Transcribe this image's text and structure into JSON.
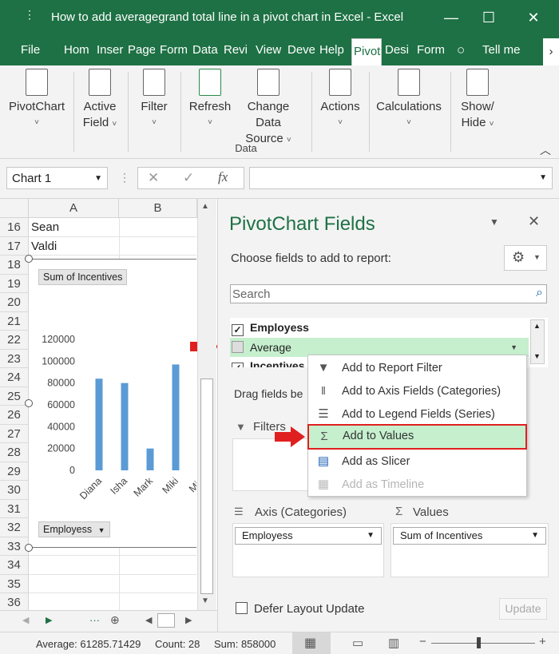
{
  "window": {
    "title": "How to add averagegrand total line in a pivot chart in Excel  -  Excel",
    "minimize": "—",
    "restore": "☐",
    "close": "✕"
  },
  "tabs": [
    "File",
    "Hom",
    "Inser",
    "Page",
    "Form",
    "Data",
    "Revi",
    "View",
    "Deve",
    "Help",
    "Pivot",
    "Desi",
    "Form",
    "Tell me"
  ],
  "ribbon": {
    "pivotchart": "PivotChart",
    "active_field_1": "Active",
    "active_field_2": "Field",
    "filter": "Filter",
    "refresh": "Refresh",
    "change_data_1": "Change Data",
    "change_data_2": "Source",
    "data_group": "Data",
    "actions": "Actions",
    "calculations": "Calculations",
    "showhide_1": "Show/",
    "showhide_2": "Hide"
  },
  "formula_bar": {
    "name_box": "Chart 1",
    "fx": "fx"
  },
  "grid": {
    "columns": [
      "A",
      "B"
    ],
    "rows": [
      "16",
      "17",
      "18",
      "19",
      "20",
      "21",
      "22",
      "23",
      "24",
      "25",
      "26",
      "27",
      "28",
      "29",
      "30",
      "31",
      "32",
      "33",
      "34",
      "35",
      "36"
    ],
    "cells": {
      "r16": "Sean",
      "r17": "Valdi"
    }
  },
  "chart": {
    "value_chip": "Sum of Incentives",
    "axis_chip": "Employess",
    "chart_data": {
      "type": "bar",
      "categories": [
        "Diana",
        "Isha",
        "Mark",
        "Miki",
        "Min"
      ],
      "values": [
        84000,
        80000,
        20000,
        97000,
        0
      ],
      "title": "",
      "ylim": [
        0,
        120000
      ],
      "yticks": [
        "120000",
        "100000",
        "80000",
        "60000",
        "40000",
        "20000",
        "0"
      ],
      "bar_color": "#5b9bd5"
    }
  },
  "pane": {
    "title": "PivotChart Fields",
    "choose_label": "Choose fields to add to report:",
    "search_placeholder": "Search",
    "fields": [
      {
        "label": "Employess",
        "checked": true
      },
      {
        "label": "Average",
        "checked": false
      },
      {
        "label": "Incentives",
        "checked": true
      }
    ],
    "drag_label": "Drag fields be",
    "filters_label": "Filters",
    "axis_label": "Axis (Categories)",
    "values_label": "Values",
    "axis_value": "Employess",
    "values_value": "Sum of Incentives",
    "defer_label": "Defer Layout Update",
    "update_button": "Update"
  },
  "context_menu": {
    "items": [
      {
        "label": "Add to Report Filter",
        "icon": "filter-icon",
        "enabled": true
      },
      {
        "label": "Add to Axis Fields (Categories)",
        "icon": "axis-icon",
        "enabled": true
      },
      {
        "label": "Add to Legend Fields (Series)",
        "icon": "legend-icon",
        "enabled": true
      },
      {
        "label": "Add to Values",
        "icon": "sigma-icon",
        "enabled": true,
        "highlighted": true
      },
      {
        "label": "Add as Slicer",
        "icon": "slicer-icon",
        "enabled": true
      },
      {
        "label": "Add as Timeline",
        "icon": "timeline-icon",
        "enabled": false
      }
    ]
  },
  "status_bar": {
    "average": "Average: 61285.71429",
    "count": "Count: 28",
    "sum": "Sum: 858000"
  },
  "colors": {
    "excel_green": "#1e7145",
    "highlight_green": "#c6efce",
    "highlight_border": "#e02020",
    "bar_blue": "#5b9bd5",
    "arrow_red": "#e02020"
  }
}
